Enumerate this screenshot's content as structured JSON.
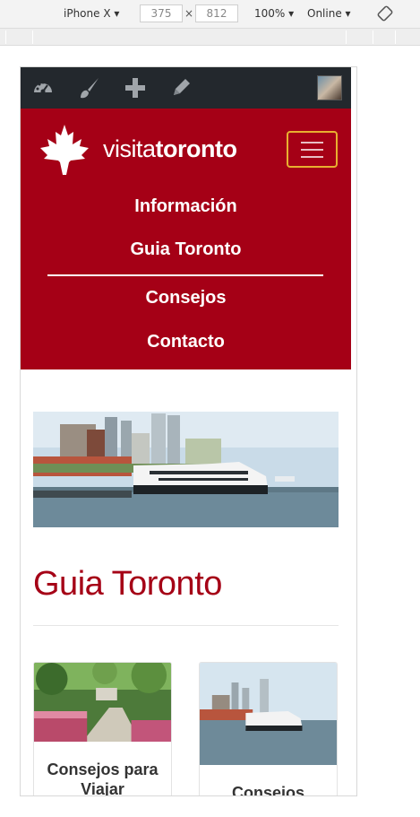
{
  "devtools": {
    "device": "iPhone X",
    "width": "375",
    "height": "812",
    "zoom": "100%",
    "throttle": "Online"
  },
  "admin_bar": {
    "icons": [
      "dashboard-icon",
      "customize-brush-icon",
      "add-new-icon",
      "edit-pencil-icon"
    ]
  },
  "site": {
    "brand_light": "visita",
    "brand_bold": "toronto"
  },
  "nav": {
    "items": [
      "Información",
      "Guia Toronto",
      "Consejos",
      "Contacto"
    ]
  },
  "page": {
    "title": "Guia Toronto"
  },
  "cards": [
    {
      "label": "Consejos para Viajar"
    },
    {
      "label": "Consejos"
    }
  ],
  "colors": {
    "brand": "#a50016",
    "admin_bar": "#23282d",
    "toggler_border": "#e8b030"
  }
}
